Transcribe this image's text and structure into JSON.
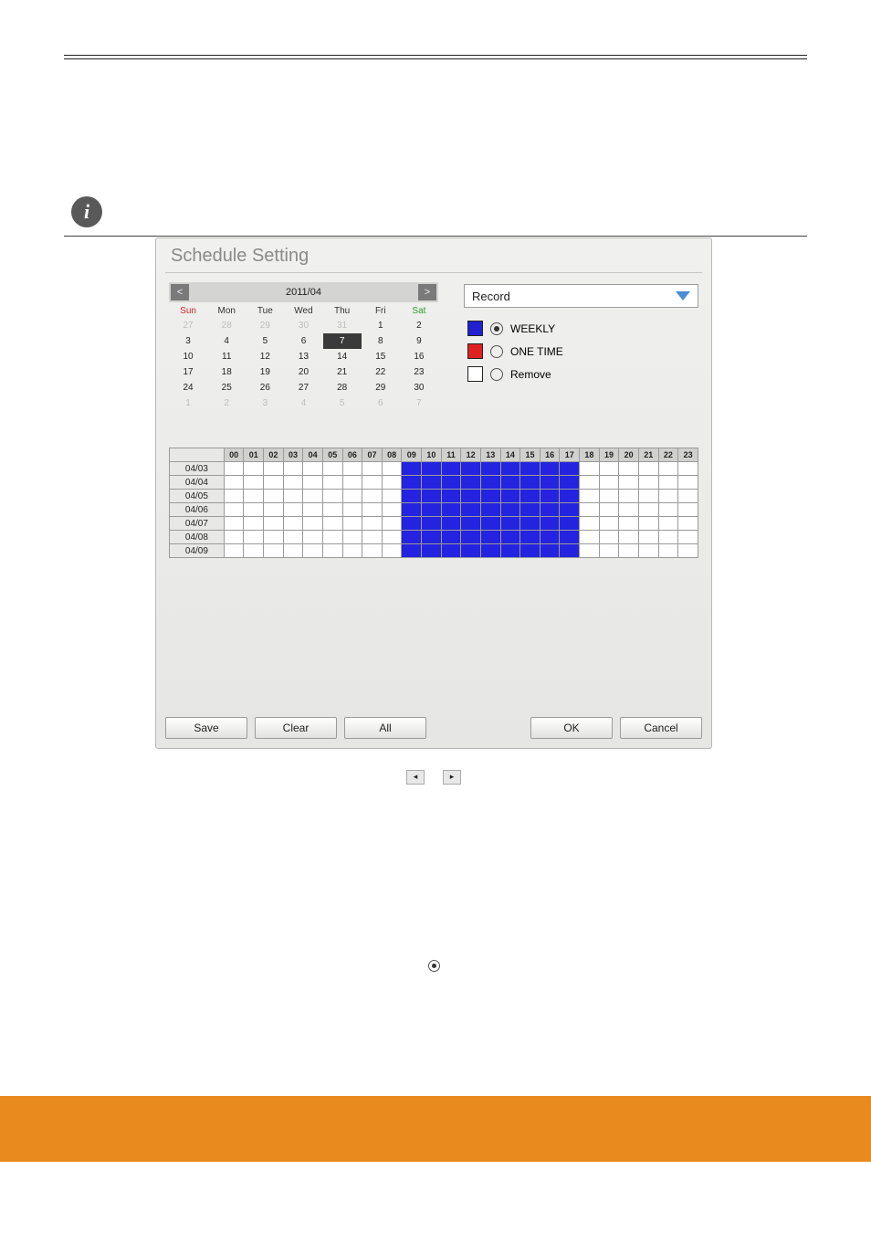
{
  "dialog": {
    "title": "Schedule Setting",
    "month_label": "2011/04",
    "nav_prev_glyph": "<",
    "nav_next_glyph": ">",
    "dow": [
      "Sun",
      "Mon",
      "Tue",
      "Wed",
      "Thu",
      "Fri",
      "Sat"
    ],
    "rows": [
      [
        {
          "d": "27",
          "dim": true
        },
        {
          "d": "28",
          "dim": true
        },
        {
          "d": "29",
          "dim": true
        },
        {
          "d": "30",
          "dim": true
        },
        {
          "d": "31",
          "dim": true
        },
        {
          "d": "1"
        },
        {
          "d": "2"
        }
      ],
      [
        {
          "d": "3"
        },
        {
          "d": "4"
        },
        {
          "d": "5"
        },
        {
          "d": "6"
        },
        {
          "d": "7",
          "sel": true
        },
        {
          "d": "8"
        },
        {
          "d": "9"
        }
      ],
      [
        {
          "d": "10"
        },
        {
          "d": "11"
        },
        {
          "d": "12"
        },
        {
          "d": "13"
        },
        {
          "d": "14"
        },
        {
          "d": "15"
        },
        {
          "d": "16"
        }
      ],
      [
        {
          "d": "17"
        },
        {
          "d": "18"
        },
        {
          "d": "19"
        },
        {
          "d": "20"
        },
        {
          "d": "21"
        },
        {
          "d": "22"
        },
        {
          "d": "23"
        }
      ],
      [
        {
          "d": "24"
        },
        {
          "d": "25"
        },
        {
          "d": "26"
        },
        {
          "d": "27"
        },
        {
          "d": "28"
        },
        {
          "d": "29"
        },
        {
          "d": "30"
        }
      ],
      [
        {
          "d": "1",
          "dim": true
        },
        {
          "d": "2",
          "dim": true
        },
        {
          "d": "3",
          "dim": true
        },
        {
          "d": "4",
          "dim": true
        },
        {
          "d": "5",
          "dim": true
        },
        {
          "d": "6",
          "dim": true
        },
        {
          "d": "7",
          "dim": true
        }
      ]
    ],
    "mode_select": "Record",
    "options": {
      "weekly": {
        "label": "WEEKLY",
        "selected": true
      },
      "one_time": {
        "label": "ONE TIME",
        "selected": false
      },
      "remove": {
        "label": "Remove",
        "selected": false
      }
    }
  },
  "schedule": {
    "hours": [
      "00",
      "01",
      "02",
      "03",
      "04",
      "05",
      "06",
      "07",
      "08",
      "09",
      "10",
      "11",
      "12",
      "13",
      "14",
      "15",
      "16",
      "17",
      "18",
      "19",
      "20",
      "21",
      "22",
      "23"
    ],
    "days": [
      {
        "label": "04/03",
        "cells": [
          0,
          0,
          0,
          0,
          0,
          0,
          0,
          0,
          0,
          1,
          1,
          1,
          1,
          1,
          1,
          1,
          1,
          1,
          0,
          0,
          0,
          0,
          0,
          0
        ]
      },
      {
        "label": "04/04",
        "cells": [
          0,
          0,
          0,
          0,
          0,
          0,
          0,
          0,
          0,
          1,
          1,
          1,
          1,
          1,
          1,
          1,
          1,
          1,
          0,
          0,
          0,
          0,
          0,
          0
        ]
      },
      {
        "label": "04/05",
        "cells": [
          0,
          0,
          0,
          0,
          0,
          0,
          0,
          0,
          0,
          1,
          1,
          1,
          1,
          1,
          1,
          1,
          1,
          1,
          0,
          0,
          0,
          0,
          0,
          0
        ]
      },
      {
        "label": "04/06",
        "cells": [
          0,
          0,
          0,
          0,
          0,
          0,
          0,
          0,
          0,
          1,
          1,
          1,
          1,
          1,
          1,
          1,
          1,
          1,
          0,
          0,
          0,
          0,
          0,
          0
        ]
      },
      {
        "label": "04/07",
        "cells": [
          0,
          0,
          0,
          0,
          0,
          0,
          0,
          0,
          0,
          1,
          1,
          1,
          1,
          1,
          1,
          1,
          1,
          1,
          0,
          0,
          0,
          0,
          0,
          0
        ]
      },
      {
        "label": "04/08",
        "cells": [
          0,
          0,
          0,
          0,
          0,
          0,
          0,
          0,
          0,
          1,
          1,
          1,
          1,
          1,
          1,
          1,
          1,
          1,
          0,
          0,
          0,
          0,
          0,
          0
        ]
      },
      {
        "label": "04/09",
        "cells": [
          0,
          0,
          0,
          0,
          0,
          0,
          0,
          0,
          0,
          1,
          1,
          1,
          1,
          1,
          1,
          1,
          1,
          1,
          0,
          0,
          0,
          0,
          0,
          0
        ]
      }
    ]
  },
  "buttons": {
    "save": "Save",
    "clear": "Clear",
    "all": "All",
    "ok": "OK",
    "cancel": "Cancel"
  },
  "body": {
    "inline_nav_prev": "◂",
    "inline_nav_next": "▸"
  }
}
